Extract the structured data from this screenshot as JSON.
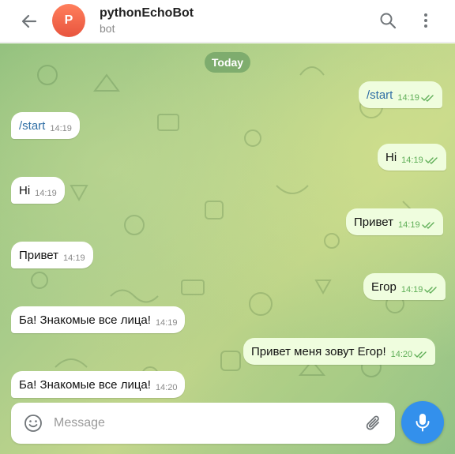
{
  "colors": {
    "accent": "#3390ec",
    "outgoing_bubble": "#effdde",
    "incoming_bubble": "#ffffff",
    "read_check": "#5fae57",
    "avatar": "#e8553e"
  },
  "header": {
    "back_icon": "arrow-left-icon",
    "avatar_letter": "P",
    "title": "pythonEchoBot",
    "subtitle": "bot",
    "search_icon": "search-icon",
    "menu_icon": "more-vertical-icon"
  },
  "chat": {
    "date_label": "Today",
    "messages": [
      {
        "direction": "out",
        "text": "/start",
        "time": "14:19",
        "is_command": true,
        "read": true
      },
      {
        "direction": "in",
        "text": "/start",
        "time": "14:19",
        "is_command": true
      },
      {
        "direction": "out",
        "text": "Hi",
        "time": "14:19",
        "read": true
      },
      {
        "direction": "in",
        "text": "Hi",
        "time": "14:19"
      },
      {
        "direction": "out",
        "text": "Привет",
        "time": "14:19",
        "read": true
      },
      {
        "direction": "in",
        "text": "Привет",
        "time": "14:19"
      },
      {
        "direction": "out",
        "text": "Егор",
        "time": "14:19",
        "read": true
      },
      {
        "direction": "in",
        "text": "Ба! Знакомые все лица!",
        "time": "14:19"
      },
      {
        "direction": "out",
        "text": "Привет меня зовут Егор!",
        "time": "14:20",
        "read": true
      },
      {
        "direction": "in",
        "text": "Ба! Знакомые все лица!",
        "time": "14:20"
      }
    ]
  },
  "composer": {
    "emoji_icon": "smile-icon",
    "placeholder": "Message",
    "value": "",
    "attach_icon": "paperclip-icon",
    "mic_icon": "microphone-icon"
  }
}
